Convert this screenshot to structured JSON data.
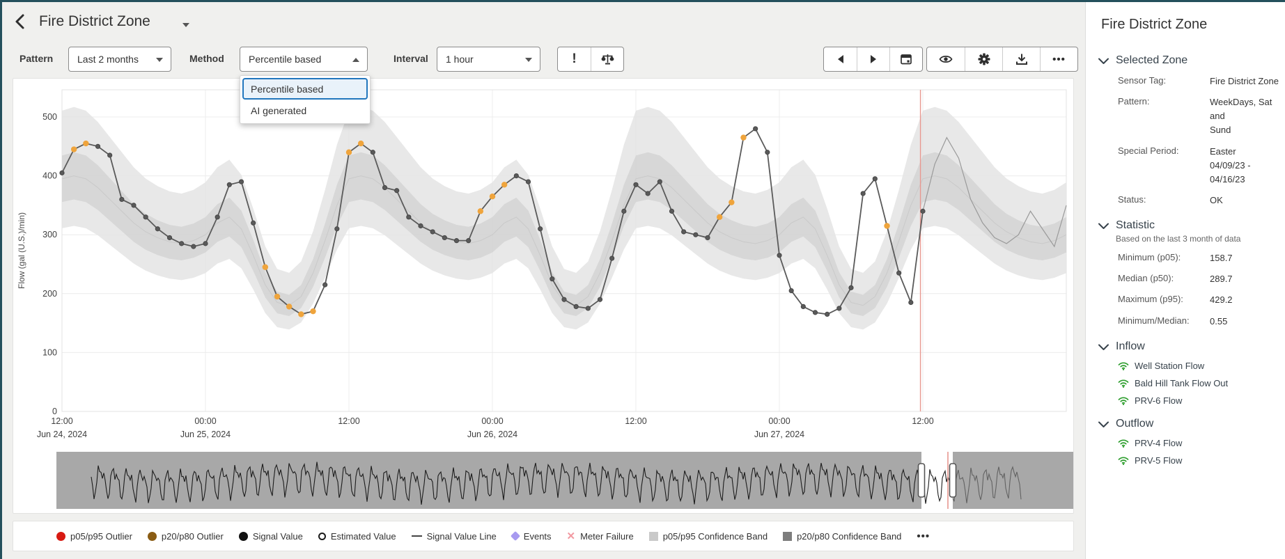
{
  "header": {
    "title": "Fire District Zone"
  },
  "toolbar": {
    "pattern_label": "Pattern",
    "pattern_value": "Last 2 months",
    "method_label": "Method",
    "method_value": "Percentile based",
    "method_options": [
      "Percentile based",
      "AI generated"
    ],
    "method_selected_index": 0,
    "interval_label": "Interval",
    "interval_value": "1 hour",
    "alert_label": "!",
    "more_label": "•••"
  },
  "legend": {
    "items": [
      {
        "label": "p05/p95 Outlier",
        "type": "circle",
        "color": "#d81a12"
      },
      {
        "label": "p20/p80 Outlier",
        "type": "circle",
        "color": "#8a5c13"
      },
      {
        "label": "Signal Value",
        "type": "circle",
        "color": "#111111"
      },
      {
        "label": "Estimated Value",
        "type": "ring",
        "color": "#111111"
      },
      {
        "label": "Signal Value Line",
        "type": "dash",
        "color": "#444444"
      },
      {
        "label": "Events",
        "type": "diamond",
        "color": "#a79af0"
      },
      {
        "label": "Meter Failure",
        "type": "cross",
        "color": "#f29aa2"
      },
      {
        "label": "p05/p95 Confidence Band",
        "type": "square",
        "color": "#c9c9c9"
      },
      {
        "label": "p20/p80 Confidence Band",
        "type": "square",
        "color": "#7d7d7d"
      }
    ],
    "more": "•••"
  },
  "sidebar": {
    "title": "Fire District Zone",
    "sections": [
      {
        "label": "Selected Zone",
        "rows": [
          {
            "label": "Sensor Tag:",
            "lines": [
              "Fire District Zone"
            ]
          },
          {
            "label": "Pattern:",
            "lines": [
              "WeekDays, Sat and",
              "Sund"
            ]
          },
          {
            "label": "Special Period:",
            "lines": [
              "Easter",
              "04/09/23 - 04/16/23"
            ]
          },
          {
            "label": "Status:",
            "lines": [
              "OK"
            ]
          }
        ]
      },
      {
        "label": "Statistic",
        "subtitle": "Based on the last 3 month of data",
        "rows": [
          {
            "label": "Minimum (p05):",
            "lines": [
              "158.7"
            ]
          },
          {
            "label": "Median (p50):",
            "lines": [
              "289.7"
            ]
          },
          {
            "label": "Maximum (p95):",
            "lines": [
              "429.2"
            ]
          },
          {
            "label": "Minimum/Median:",
            "lines": [
              "0.55"
            ]
          }
        ]
      },
      {
        "label": "Inflow",
        "items": [
          "Well Station Flow",
          "Bald Hill Tank Flow Out",
          "PRV-6 Flow"
        ]
      },
      {
        "label": "Outflow",
        "items": [
          "PRV-4 Flow",
          "PRV-5 Flow"
        ]
      }
    ]
  },
  "chart_data": {
    "type": "line",
    "title": "",
    "ylabel": "Flow (gal (U.S.)/min)",
    "ylim": [
      0,
      546
    ],
    "yticks": [
      0,
      100,
      200,
      300,
      400,
      500
    ],
    "hours_total": 84,
    "xticks": [
      {
        "h": 0,
        "time": "12:00",
        "date": "Jun 24, 2024"
      },
      {
        "h": 12,
        "time": "00:00",
        "date": "Jun 25, 2024"
      },
      {
        "h": 24,
        "time": "12:00",
        "date": ""
      },
      {
        "h": 36,
        "time": "00:00",
        "date": "Jun 26, 2024"
      },
      {
        "h": 48,
        "time": "12:00",
        "date": ""
      },
      {
        "h": 60,
        "time": "00:00",
        "date": "Jun 27, 2024"
      },
      {
        "h": 72,
        "time": "12:00",
        "date": ""
      }
    ],
    "signal": [
      405,
      445,
      455,
      450,
      435,
      360,
      350,
      330,
      310,
      295,
      285,
      280,
      285,
      330,
      385,
      390,
      320,
      245,
      195,
      178,
      165,
      170,
      215,
      310,
      440,
      455,
      440,
      380,
      375,
      330,
      315,
      305,
      295,
      290,
      290,
      340,
      365,
      385,
      400,
      390,
      310,
      225,
      190,
      178,
      175,
      190,
      260,
      340,
      385,
      370,
      390,
      340,
      305,
      300,
      295,
      330,
      355,
      465,
      480,
      440,
      265,
      205,
      178,
      168,
      165,
      175,
      210,
      370,
      395,
      315,
      235,
      185,
      340
    ],
    "outlier_idx": [
      1,
      2,
      17,
      18,
      19,
      20,
      21,
      24,
      25,
      35,
      36,
      37,
      55,
      56,
      57,
      69
    ],
    "forecast_start_h": 72,
    "forecast": [
      340,
      420,
      465,
      430,
      360,
      320,
      295,
      285,
      300,
      340,
      310,
      280,
      350
    ],
    "p50_pattern_from_1200": [
      395,
      400,
      395,
      380,
      360,
      340,
      320,
      305,
      295,
      288,
      285,
      290,
      300,
      320,
      330,
      310,
      265,
      215,
      185,
      180,
      195,
      235,
      290,
      350
    ],
    "bands": {
      "p95_mul": 1.28,
      "p95_add": 5,
      "p80_mul": 1.1,
      "p20_mul": 0.9,
      "p05_mul": 0.8,
      "p05_add": -5
    },
    "marker_line_h": 71.8,
    "colors": {
      "signal": "#5a5a5a",
      "outlier": "#efa43c",
      "band_light": "#e4e4e4",
      "band_dark": "#d2d2d2",
      "median": "#c9c9c9",
      "marker": "#e89890",
      "forecast": "#9a9a9a",
      "grid": "#ececec",
      "axis_text": "#3f3f3f"
    },
    "minimap": {
      "bg": "#a8a8a8",
      "wave": "#1c1c1c",
      "dim_wave": "#626262",
      "window_x1": 1242,
      "window_x2": 1287,
      "red_x": 1280,
      "wave_start": 50,
      "dim_end": 1385
    }
  }
}
